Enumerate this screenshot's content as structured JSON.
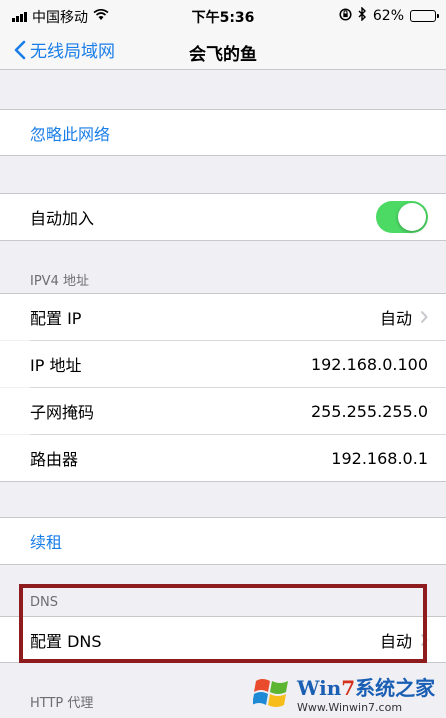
{
  "status_bar": {
    "carrier": "中国移动",
    "time": "下午5:36",
    "battery_pct": "62%",
    "battery_level": 0.62
  },
  "nav": {
    "back_label": "无线局域网",
    "title": "会飞的鱼"
  },
  "forget_network": "忽略此网络",
  "auto_join": {
    "label": "自动加入",
    "enabled": true
  },
  "ipv4": {
    "header": "IPV4 地址",
    "rows": [
      {
        "label": "配置 IP",
        "value": "自动"
      },
      {
        "label": "IP 地址",
        "value": "192.168.0.100"
      },
      {
        "label": "子网掩码",
        "value": "255.255.255.0"
      },
      {
        "label": "路由器",
        "value": "192.168.0.1"
      }
    ]
  },
  "renew_lease": "续租",
  "dns": {
    "header": "DNS",
    "configure_label": "配置 DNS",
    "configure_value": "自动"
  },
  "http_proxy": {
    "header": "HTTP 代理"
  },
  "watermark": {
    "brand_prefix": "Win",
    "brand_seven": "7",
    "brand_suffix": "系统之家",
    "url": "Www.Winwin7.com"
  },
  "colors": {
    "accent": "#1a7ee8",
    "toggle_on": "#4cd964",
    "highlight_border": "#8e1b1e",
    "background": "#efeff4"
  }
}
